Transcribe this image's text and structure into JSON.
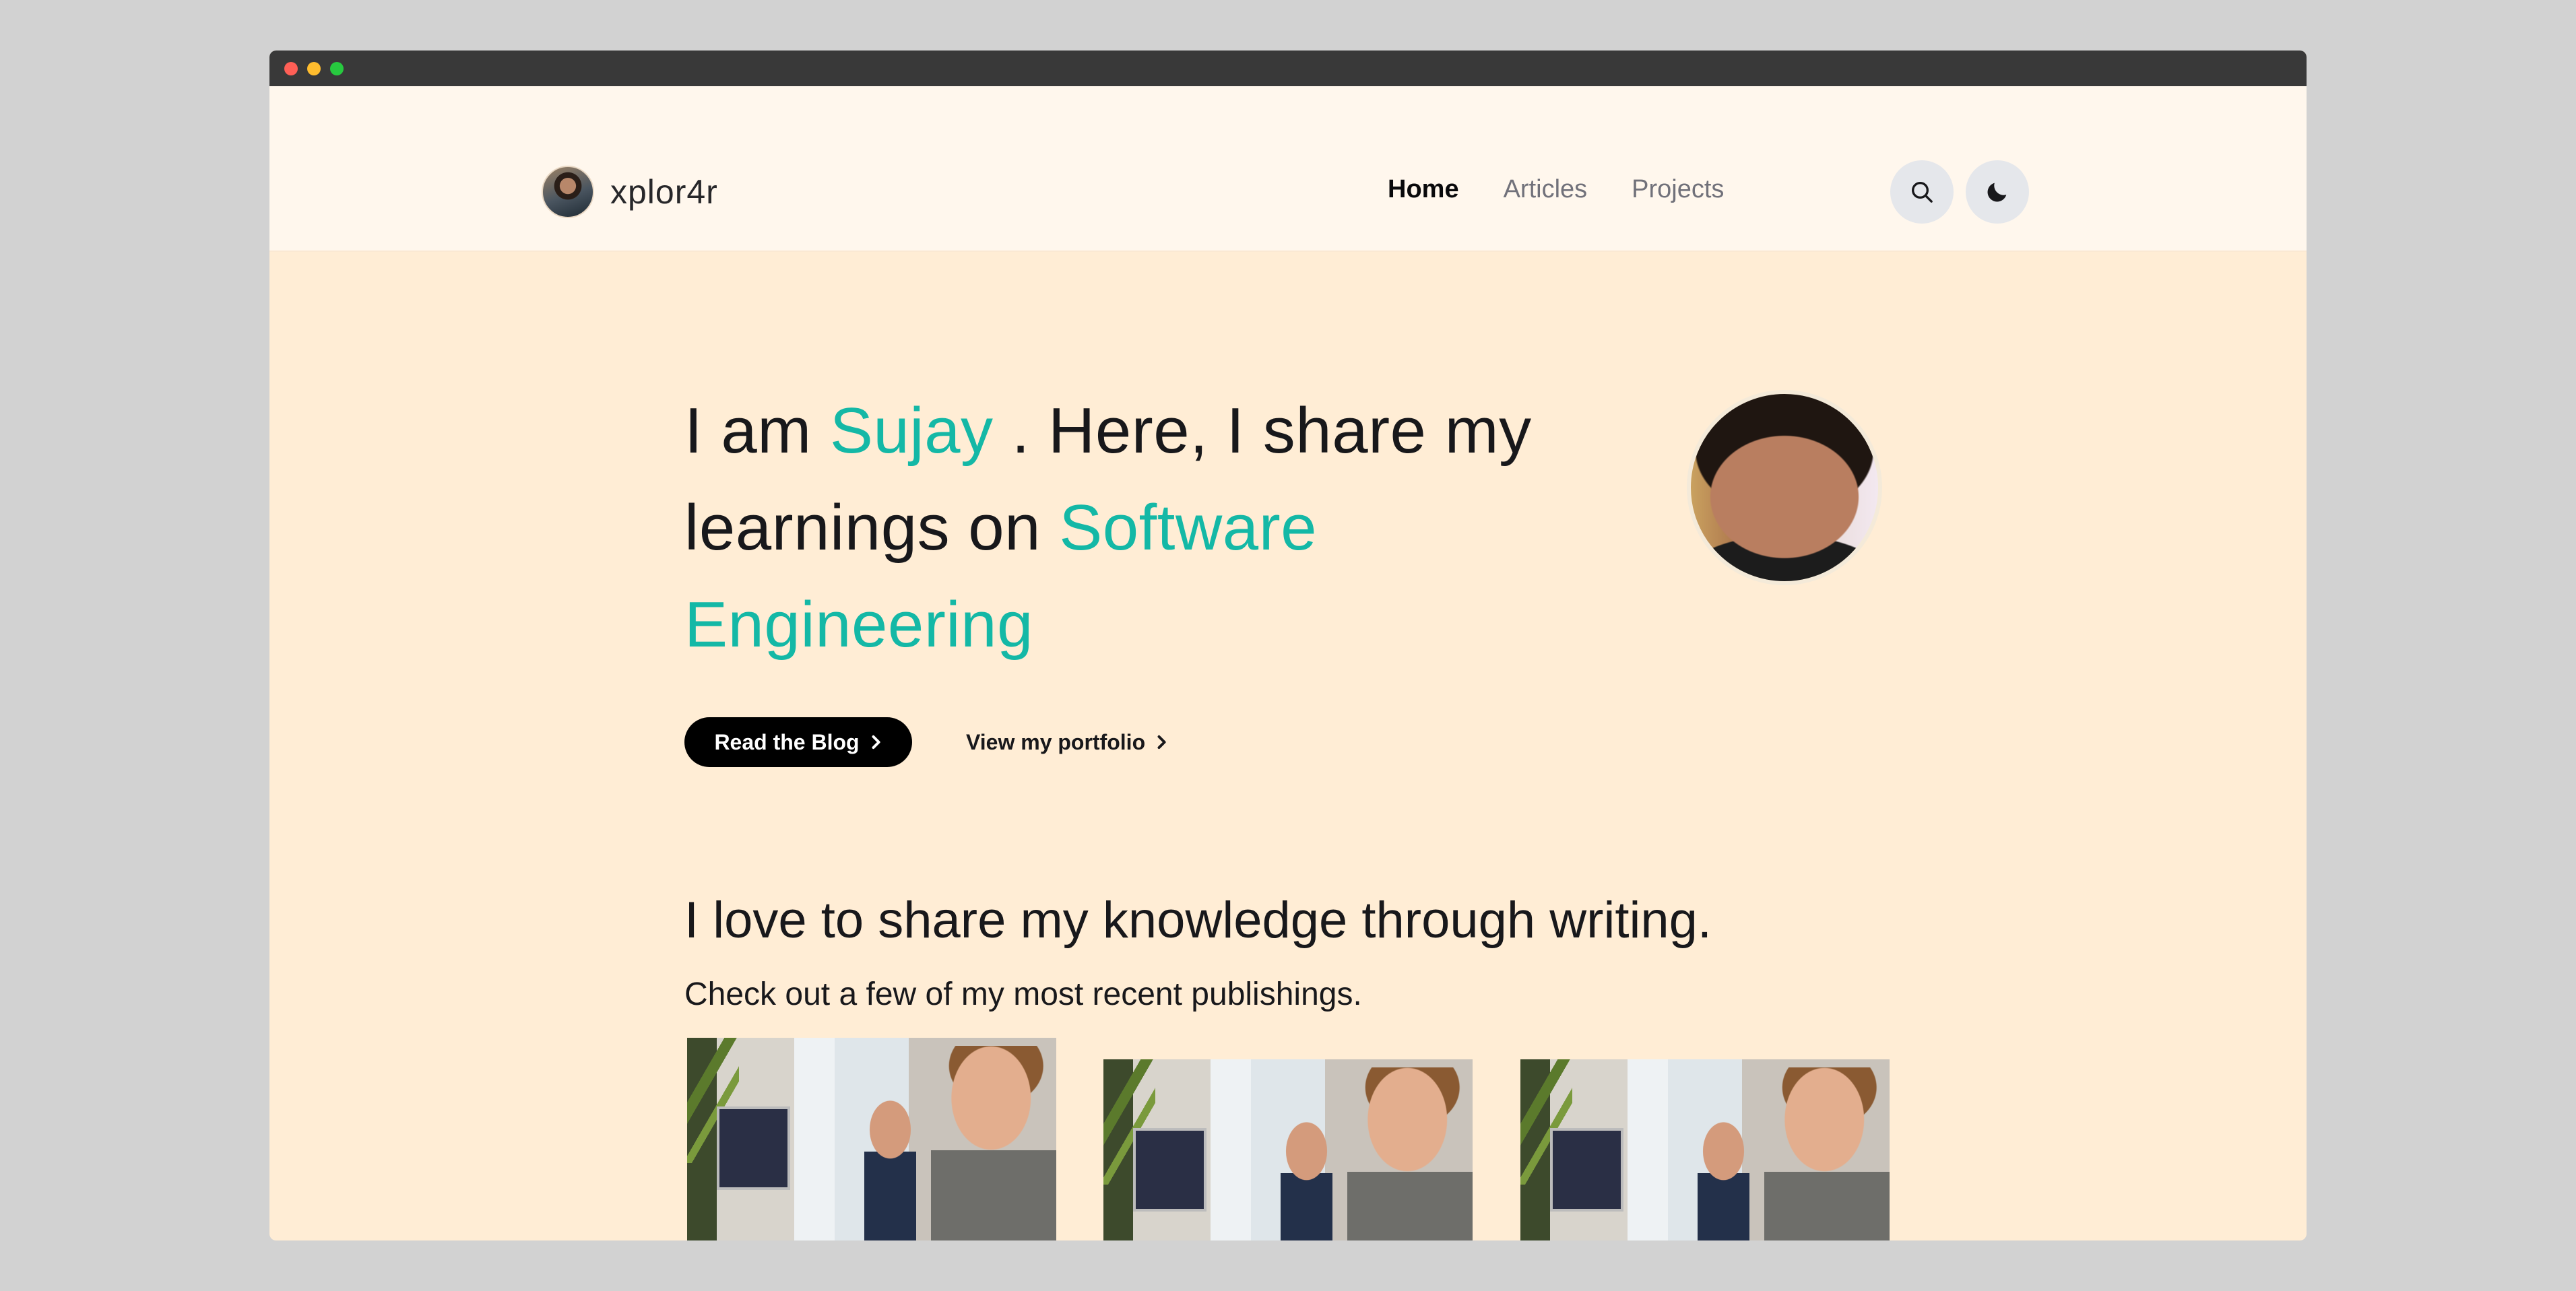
{
  "brand": {
    "name": "xplor4r"
  },
  "nav": {
    "links": [
      {
        "label": "Home",
        "active": true
      },
      {
        "label": "Articles",
        "active": false
      },
      {
        "label": "Projects",
        "active": false
      }
    ],
    "search_icon": "search-icon",
    "theme_icon": "moon-icon"
  },
  "hero": {
    "line1_prefix": "I am",
    "line1_name": "Sujay",
    "line1_suffix": ". Here, I share my",
    "line2_prefix": "learnings on",
    "line2_accent": "Software",
    "line3_accent": "Engineering"
  },
  "cta": {
    "primary_label": "Read the Blog",
    "secondary_label": "View my portfolio"
  },
  "publications": {
    "title": "I love to share my knowledge through writing.",
    "subtitle": "Check out a few of my most recent publishings."
  },
  "colors": {
    "accent": "#14b8a6",
    "page_bg": "#ffedd5",
    "nav_bg": "#fff7ed",
    "button_bg": "#000000"
  }
}
